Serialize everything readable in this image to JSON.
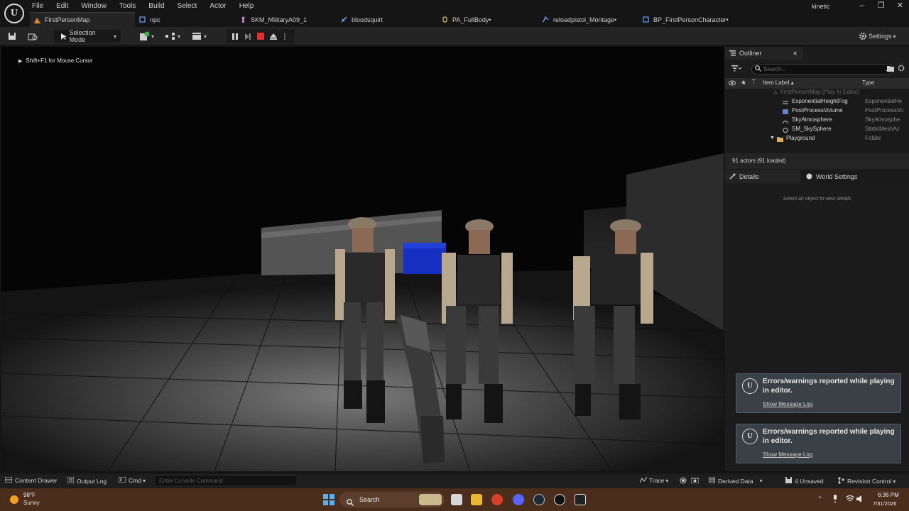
{
  "menu": [
    "File",
    "Edit",
    "Window",
    "Tools",
    "Build",
    "Select",
    "Actor",
    "Help"
  ],
  "tabs": [
    {
      "label": "FirstPersonMap",
      "active": true
    },
    {
      "label": "npc",
      "active": false
    },
    {
      "label": "SKM_MilitaryA09_1",
      "active": false
    },
    {
      "label": "bloodsquirt",
      "active": false
    },
    {
      "label": "PA_FullBody•",
      "active": false
    },
    {
      "label": "reloadpistol_Montage•",
      "active": false
    },
    {
      "label": "BP_FirstPersonCharacter•",
      "active": false
    }
  ],
  "window": {
    "user": "kinetic"
  },
  "toolbar": {
    "selection_mode": "Selection Mode",
    "settings": "Settings"
  },
  "viewport": {
    "hint": "Shift+F1 for Mouse Cursor"
  },
  "outliner": {
    "title": "Outliner",
    "search_placeholder": "Search...",
    "col_label": "Item Label ▴",
    "col_type": "Type",
    "root": "FirstPersonMap (Play In Editor)",
    "rows": [
      {
        "label": "ExponentialHeightFog",
        "type": "ExponentialHe"
      },
      {
        "label": "PostProcessVolume",
        "type": "PostProcessVo"
      },
      {
        "label": "SkyAtmosphere",
        "type": "SkyAtmosphe"
      },
      {
        "label": "SM_SkySphere",
        "type": "StaticMeshAc"
      },
      {
        "label": "Playground",
        "type": "Folder"
      }
    ],
    "actors": "91 actors (91 loaded)"
  },
  "details": {
    "tab": "Details",
    "world_tab": "World Settings",
    "hint": "Select an object to view details"
  },
  "notices": [
    {
      "text": "Errors/warnings reported while playing in editor.",
      "link": "Show Message Log"
    },
    {
      "text": "Errors/warnings reported while playing in editor.",
      "link": "Show Message Log"
    }
  ],
  "statusbar": {
    "content_drawer": "Content Drawer",
    "output_log": "Output Log",
    "cmd": "Cmd",
    "console_placeholder": "Enter Console Command",
    "trace": "Trace",
    "derived_data": "Derived Data",
    "unsaved": "4 Unsaved",
    "revision_control": "Revision Control"
  },
  "taskbar": {
    "temp": "98°F",
    "weather": "Sunny",
    "search": "Search",
    "time": "6:36 PM",
    "date": "7/31/2026"
  },
  "colors": {
    "accent": "#e08a2a",
    "stop": "#e03030",
    "folder": "#d9b060",
    "blue_cube": "#1530c0"
  }
}
